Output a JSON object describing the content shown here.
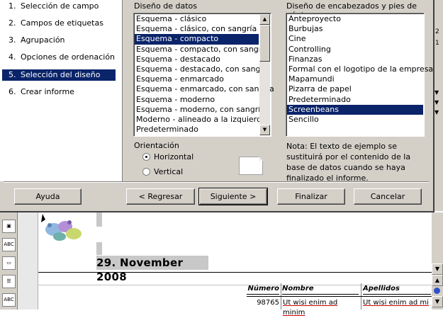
{
  "wizard": {
    "steps": [
      {
        "num": "1.",
        "label": "Selección de campo"
      },
      {
        "num": "2.",
        "label": "Campos de etiquetas"
      },
      {
        "num": "3.",
        "label": "Agrupación"
      },
      {
        "num": "4.",
        "label": "Opciones de ordenación"
      },
      {
        "num": "5.",
        "label": "Selección del diseño"
      },
      {
        "num": "6.",
        "label": "Crear informe"
      }
    ],
    "selected_step": 4,
    "data_layout": {
      "label": "Diseño de datos",
      "items": [
        "Esquema - clásico",
        "Esquema - clásico, con sangría",
        "Esquema - compacto",
        "Esquema - compacto, con sangría",
        "Esquema - destacado",
        "Esquema - destacado, con sangría",
        "Esquema - enmarcado",
        "Esquema - enmarcado, con sangría",
        "Esquema - moderno",
        "Esquema - moderno, con sangría",
        "Moderno - alineado a la izquierda",
        "Predeterminado"
      ],
      "selected": "Esquema - compacto"
    },
    "header_layout": {
      "label": "Diseño de encabezados y pies de página",
      "items": [
        "Anteproyecto",
        "Burbujas",
        "Cine",
        "Controlling",
        "Finanzas",
        "Formal con el logotipo de la empresa",
        "Mapamundi",
        "Pizarra de papel",
        "Predeterminado",
        "Screenbeans",
        "Sencillo"
      ],
      "selected": "Screenbeans"
    },
    "orientation": {
      "label": "Orientación",
      "options": [
        "Horizontal",
        "Vertical"
      ],
      "selected": "Horizontal"
    },
    "note": "Nota: El texto de ejemplo se sustituirá por el contenido de la base de datos cuando se haya finalizado el informe.",
    "buttons": {
      "help": "Ayuda",
      "back": "< Regresar",
      "next": "Siguiente >",
      "finish": "Finalizar",
      "cancel": "Cancelar"
    }
  },
  "document": {
    "date": "29. November 2008",
    "columns": [
      "Número",
      "Nombre",
      "Apellidos"
    ],
    "row": [
      "98765",
      "Ut wisi enim ad minim",
      "Ut wisi enim ad mi"
    ],
    "edge_digits": [
      "2",
      "1"
    ]
  }
}
